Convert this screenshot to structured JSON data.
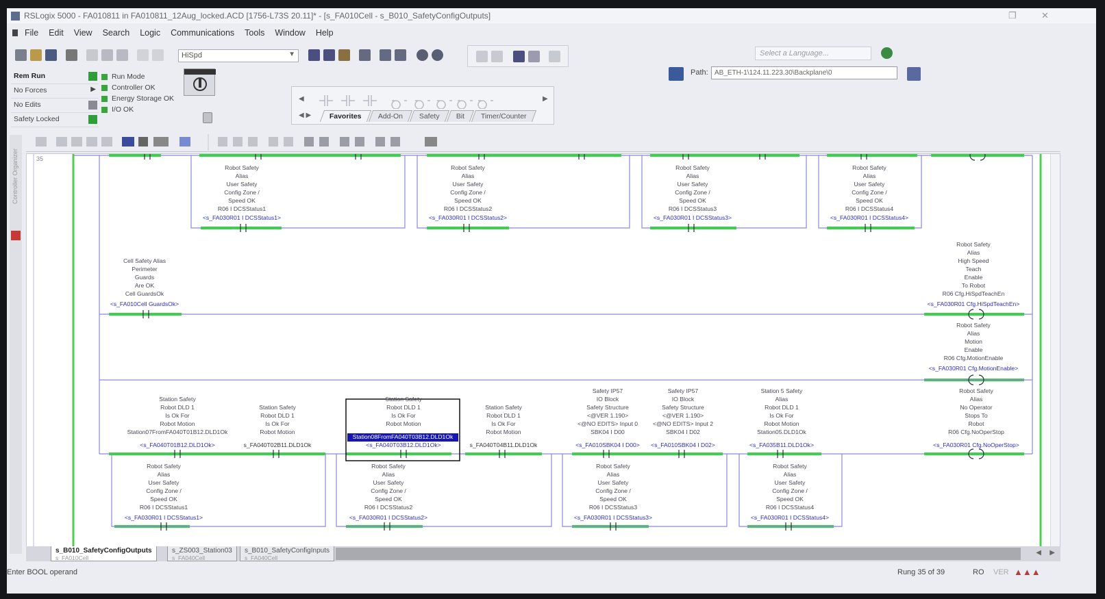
{
  "window": {
    "title": "RSLogix 5000 - FA010811 in FA010811_12Aug_locked.ACD [1756-L73S 20.11]* - [s_FA010Cell - s_B010_SafetyConfigOutputs]"
  },
  "menu": [
    "File",
    "Edit",
    "View",
    "Search",
    "Logic",
    "Communications",
    "Tools",
    "Window",
    "Help"
  ],
  "toolbar": {
    "routine_combo": "HiSpd",
    "language_placeholder": "Select a Language...",
    "path_label": "Path:",
    "path_value": "AB_ETH-1\\124.11.223.30\\Backplane\\0"
  },
  "controller_status": [
    {
      "label": "Rem Run"
    },
    {
      "label": "No Forces"
    },
    {
      "label": "No Edits"
    },
    {
      "label": "Safety Locked"
    }
  ],
  "checks": [
    "Run Mode",
    "Controller OK",
    "Energy Storage OK",
    "I/O OK"
  ],
  "instruction_tabs": [
    "Favorites",
    "Add-On",
    "Safety",
    "Bit",
    "Timer/Counter"
  ],
  "ladder": {
    "top_coils": [
      {
        "desc": "Robot Safety\nAlias\nUser Safety\nConfig Zone /\nSpeed OK\nR06 I DCSStatus1",
        "addr": "<s_FA030R01 I DCSStatus1>"
      },
      {
        "desc": "Robot Safety\nAlias\nUser Safety\nConfig Zone /\nSpeed OK\nR06 I DCSStatus2",
        "addr": "<s_FA030R01 I DCSStatus2>"
      },
      {
        "desc": "Robot Safety\nAlias\nUser Safety\nConfig Zone /\nSpeed OK\nR06 I DCSStatus3",
        "addr": "<s_FA030R01 I DCSStatus3>"
      },
      {
        "desc": "Robot Safety\nAlias\nUser Safety\nConfig Zone /\nSpeed OK\nR06 I DCSStatus4",
        "addr": "<s_FA030R01 I DCSStatus4>"
      }
    ],
    "cell_guards": {
      "desc": "Cell Safety Alias\nPerimeter\nGuards\nAre OK\nCell GuardsOk",
      "addr": "<s_FA010Cell GuardsOk>"
    },
    "out_hispeed": {
      "desc": "Robot Safety\nAlias\nHigh Speed\nTeach\nEnable\nTo Robot\nR06 Cfg.HiSpdTeachEn",
      "addr": "<s_FA030R01 Cfg.HiSpdTeachEn>"
    },
    "out_motion": {
      "desc": "Robot Safety\nAlias\nMotion\nEnable\nR06 Cfg.MotionEnable",
      "addr": "<s_FA030R01 Cfg.MotionEnable>"
    },
    "out_noop": {
      "desc": "Robot Safety\nAlias\nNo Operator\nStops To\nRobot\nR06 Cfg.NoOperStop",
      "addr": "<s_FA030R01 Cfg.NoOperStop>"
    },
    "rung_contacts": [
      {
        "desc": "Station Safety\nRobot DLD 1\nIs Ok For\nRobot Motion\nStation07FromFA040T01B12.DLD1Ok",
        "addr": "<s_FA040T01B12.DLD1Ok>"
      },
      {
        "desc": "Station Safety\nRobot DLD 1\nIs Ok For\nRobot Motion",
        "baddr": "s_FA040T02B11.DLD1Ok"
      },
      {
        "desc": "Station Safety\nRobot DLD 1\nIs Ok For\nRobot Motion",
        "sel": "Station08FromFA040T03B12.DLD1Ok",
        "addr": "<s_FA040T03B12.DLD1Ok>"
      },
      {
        "desc": "Station Safety\nRobot DLD 1\nIs Ok For\nRobot Motion",
        "baddr": "s_FA040T04B11.DLD1Ok"
      },
      {
        "desc": "Safety IP57\nIO Block\nSafety Structure\n<@VER 1.190>\n<@NO EDITS> Input 0\nSBK04 I D00",
        "addr": "<s_FA010SBK04 I D00>"
      },
      {
        "desc": "Safety IP57\nIO Block\nSafety Structure\n<@VER 1.190>\n<@NO EDITS> Input 2\nSBK04 I D02",
        "addr": "<s_FA010SBK04 I D02>"
      },
      {
        "desc": "Station 5 Safety\nAlias\nRobot DLD 1\nIs Ok For\nRobot Motion\nStation05.DLD1Ok",
        "addr": "<s_FA035B11.DLD1Ok>"
      }
    ],
    "bottom_coils": [
      {
        "desc": "Robot Safety\nAlias\nUser Safety\nConfig Zone /\nSpeed OK\nR06 I DCSStatus1",
        "addr": "<s_FA030R01 I DCSStatus1>"
      },
      {
        "desc": "Robot Safety\nAlias\nUser Safety\nConfig Zone /\nSpeed OK\nR06 I DCSStatus2",
        "addr": "<s_FA030R01 I DCSStatus2>"
      },
      {
        "desc": "Robot Safety\nAlias\nUser Safety\nConfig Zone /\nSpeed OK\nR06 I DCSStatus3",
        "addr": "<s_FA030R01 I DCSStatus3>"
      },
      {
        "desc": "Robot Safety\nAlias\nUser Safety\nConfig Zone /\nSpeed OK\nR06 I DCSStatus4",
        "addr": "<s_FA030R01 I DCSStatus4>"
      }
    ]
  },
  "routine_tabs": [
    {
      "name": "s_B010_SafetyConfigOutputs",
      "sub": "s_FA010Cell"
    },
    {
      "name": "s_ZS003_Station03",
      "sub": "s_FA040Cell"
    },
    {
      "name": "s_B010_SafetyConfigInputs",
      "sub": "s_FA040Cell"
    }
  ],
  "status": {
    "message": "Enter BOOL operand",
    "rung": "Rung 35 of 39",
    "mode": "RO",
    "ver": "VER"
  },
  "colors": {
    "energized": "#3bd14a",
    "rung": "#8b88d8",
    "rail": "#4fcf4f",
    "select": "#1616b4"
  }
}
